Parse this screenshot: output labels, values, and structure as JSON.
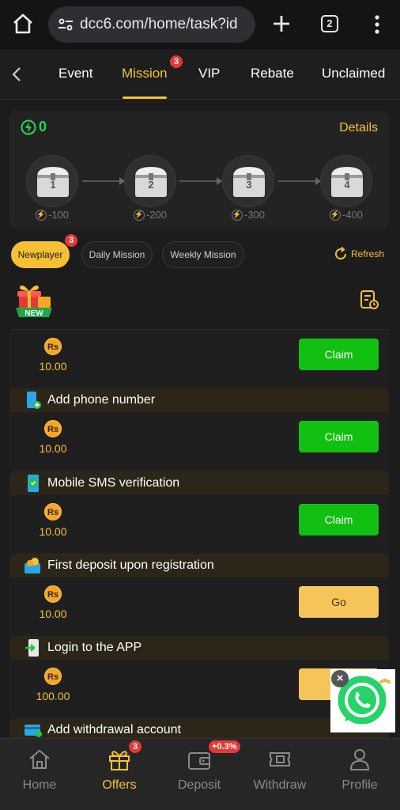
{
  "browser": {
    "url": "dcc6.com/home/task?id",
    "tab_count": "2"
  },
  "tabs": [
    {
      "label": "Event"
    },
    {
      "label": "Mission",
      "badge": "3"
    },
    {
      "label": "VIP"
    },
    {
      "label": "Rebate"
    },
    {
      "label": "Unclaimed"
    }
  ],
  "rewards": {
    "points": "0",
    "details_label": "Details",
    "chests": [
      {
        "num": "1",
        "cost": "-100"
      },
      {
        "num": "2",
        "cost": "-200"
      },
      {
        "num": "3",
        "cost": "-300"
      },
      {
        "num": "4",
        "cost": "-400"
      }
    ]
  },
  "filters": {
    "newplayer": {
      "label": "Newplayer",
      "badge": "3"
    },
    "daily": "Daily Mission",
    "weekly": "Weekly Mission",
    "refresh": "Refresh",
    "new_label": "NEW"
  },
  "missions": [
    {
      "title": "",
      "coin": "Rs",
      "amount": "10.00",
      "action": "Claim"
    },
    {
      "title": "Add phone number",
      "coin": "Rs",
      "amount": "10.00",
      "action": "Claim"
    },
    {
      "title": "Mobile SMS verification",
      "coin": "Rs",
      "amount": "10.00",
      "action": "Claim"
    },
    {
      "title": "First deposit upon registration",
      "coin": "Rs",
      "amount": "10.00",
      "action": "Go"
    },
    {
      "title": "Login to the APP",
      "coin": "Rs",
      "amount": "100.00",
      "action": ""
    },
    {
      "title": "Add withdrawal account"
    }
  ],
  "bottom_nav": [
    {
      "label": "Home"
    },
    {
      "label": "Offers",
      "badge": "3"
    },
    {
      "label": "Deposit",
      "badge": "+0.3%"
    },
    {
      "label": "Withdraw"
    },
    {
      "label": "Profile"
    }
  ],
  "colors": {
    "accent": "#f5c033",
    "claim_green": "#12c012",
    "go_yellow": "#f5c55a",
    "badge_red": "#e53935",
    "background": "#1c1c1c"
  }
}
